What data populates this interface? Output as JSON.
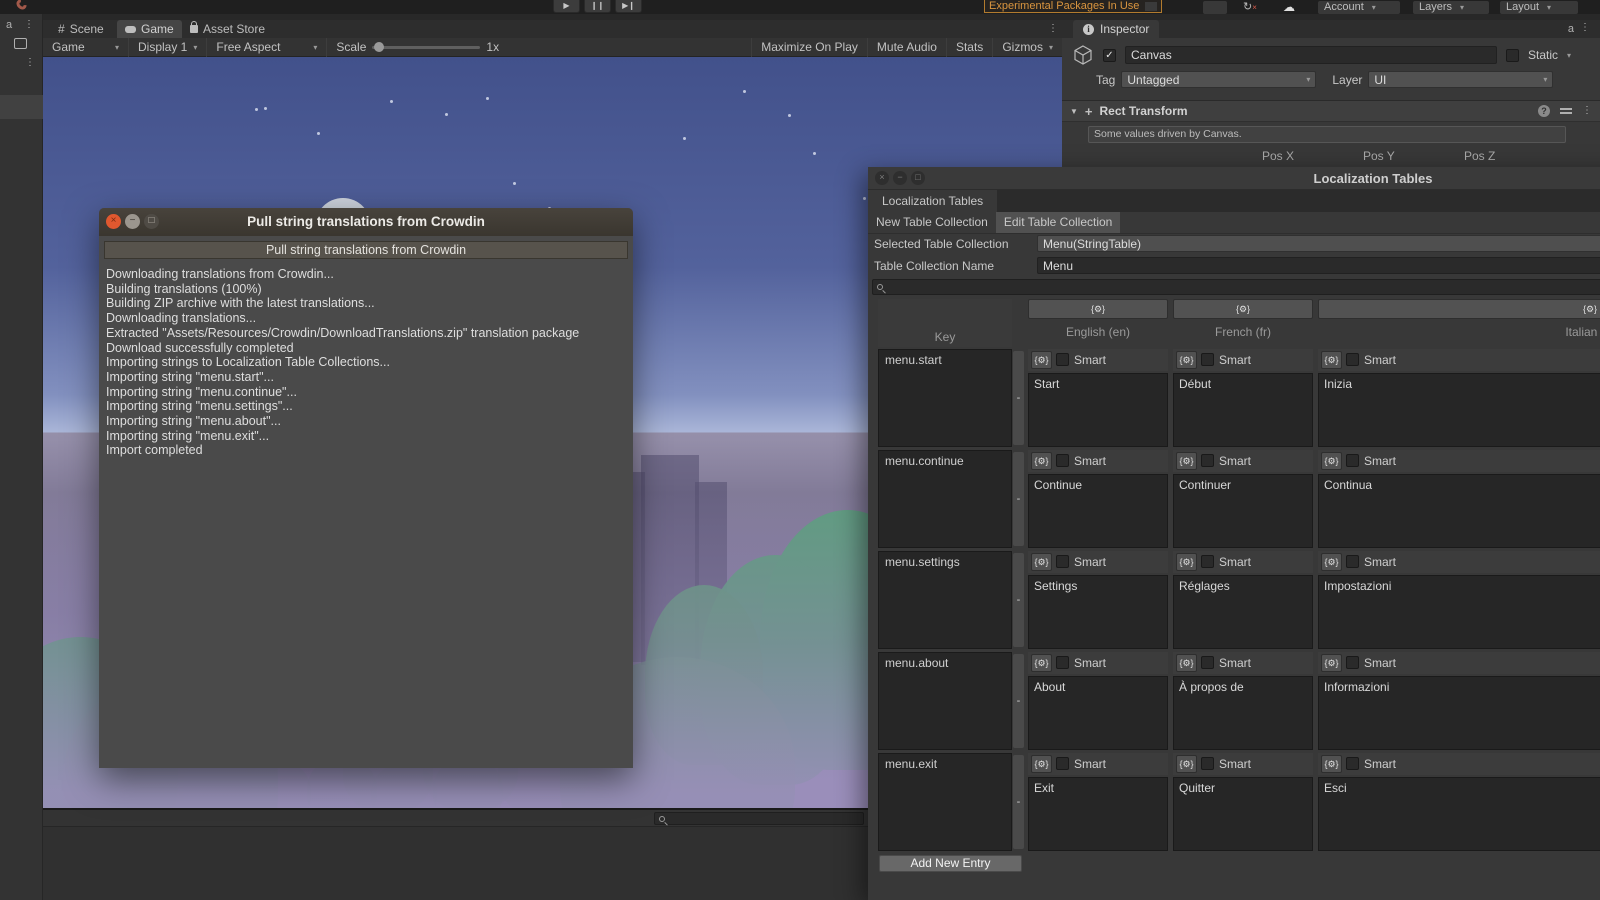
{
  "top_bar": {
    "play": "▶",
    "pause": "❙❙",
    "step": "▶❙",
    "experimental_warning": "Experimental Packages In Use",
    "account": "Account",
    "layers": "Layers",
    "layout": "Layout"
  },
  "tabs": {
    "scene": "Scene",
    "game": "Game",
    "asset_store": "Asset Store"
  },
  "game_toolbar": {
    "display_target": "Game",
    "display": "Display 1",
    "aspect": "Free Aspect",
    "scale_label": "Scale",
    "scale_value": "1x",
    "maximize": "Maximize On Play",
    "mute": "Mute Audio",
    "stats": "Stats",
    "gizmos": "Gizmos"
  },
  "inspector": {
    "tab": "Inspector",
    "object_name": "Canvas",
    "static_label": "Static",
    "tag_label": "Tag",
    "tag_value": "Untagged",
    "layer_label": "Layer",
    "layer_value": "UI",
    "component": "Rect Transform",
    "driven_note": "Some values driven by Canvas.",
    "pos_x": "Pos X",
    "pos_y": "Pos Y",
    "pos_z": "Pos Z",
    "help_icon": "?"
  },
  "crowdin_dialog": {
    "title": "Pull string translations from Crowdin",
    "button": "Pull string translations from Crowdin",
    "log": [
      "Downloading translations from Crowdin...",
      "Building translations (100%)",
      "Building ZIP archive with the latest translations...",
      "Downloading translations...",
      "Extracted \"Assets/Resources/Crowdin/DownloadTranslations.zip\" translation package",
      "Download successfully completed",
      "Importing strings to Localization Table Collections...",
      "Importing string \"menu.start\"...",
      "Importing string \"menu.continue\"...",
      "Importing string \"menu.settings\"...",
      "Importing string \"menu.about\"...",
      "Importing string \"menu.exit\"...",
      "Import completed"
    ]
  },
  "localization": {
    "window_title": "Localization Tables",
    "tab": "Localization Tables",
    "new_button": "New Table Collection",
    "edit_button": "Edit Table Collection",
    "selected_label": "Selected Table Collection",
    "selected_value": "Menu(StringTable)",
    "name_label": "Table Collection Name",
    "name_value": "Menu",
    "key_header": "Key",
    "smart_label": "Smart",
    "metadata_icon": "{⚙}",
    "remove_glyph": "-",
    "add_button": "Add New Entry",
    "columns": [
      "English (en)",
      "French (fr)",
      "Italian (it)"
    ],
    "rows": [
      {
        "key": "menu.start",
        "values": [
          "Start",
          "Début",
          "Inizia"
        ]
      },
      {
        "key": "menu.continue",
        "values": [
          "Continue",
          "Continuer",
          "Continua"
        ]
      },
      {
        "key": "menu.settings",
        "values": [
          "Settings",
          "Réglages",
          "Impostazioni"
        ]
      },
      {
        "key": "menu.about",
        "values": [
          "About",
          "À propos de",
          "Informazioni"
        ]
      },
      {
        "key": "menu.exit",
        "values": [
          "Exit",
          "Quitter",
          "Esci"
        ]
      }
    ]
  },
  "colors": {
    "ubuntu_close_orange": "#e0582f",
    "experimental_warning_text": "#d9953f",
    "editor_panel_bg": "#383838",
    "field_dark_bg": "#262626"
  }
}
